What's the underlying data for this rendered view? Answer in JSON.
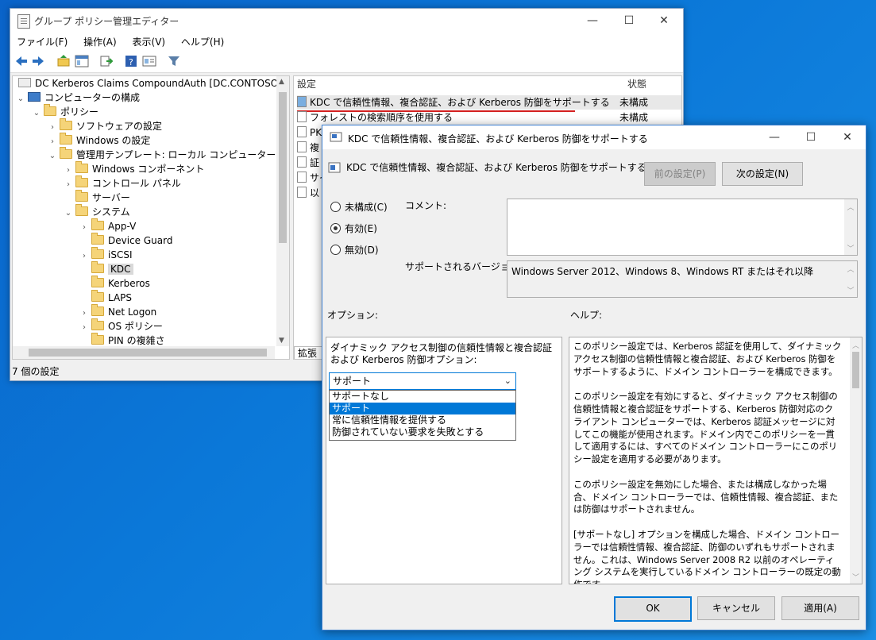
{
  "gpm": {
    "title": "グループ ポリシー管理エディター",
    "menu": [
      "ファイル(F)",
      "操作(A)",
      "表示(V)",
      "ヘルプ(H)"
    ],
    "tree": {
      "root": "DC Kerberos Claims CompoundAuth [DC.CONTOSO.COM]",
      "computer_config": "コンピューターの構成",
      "policies": "ポリシー",
      "software_settings": "ソフトウェアの設定",
      "windows_settings": "Windows の設定",
      "admin_templates": "管理用テンプレート: ローカル コンピューターから取得した",
      "windows_components": "Windows コンポーネント",
      "control_panel": "コントロール パネル",
      "server": "サーバー",
      "system": "システム",
      "system_children": [
        "App-V",
        "Device Guard",
        "iSCSI",
        "KDC",
        "Kerberos",
        "LAPS",
        "Net Logon",
        "OS ポリシー",
        "PIN の複雑さ"
      ]
    },
    "list": {
      "col_setting": "設定",
      "col_state": "状態",
      "rows": [
        {
          "name": "KDC で信頼性情報、複合認証、および Kerberos 防御をサポートする",
          "state": "未構成"
        },
        {
          "name": "フォレストの検索順序を使用する",
          "state": "未構成"
        },
        {
          "name": "PK",
          "state": ""
        },
        {
          "name": "複",
          "state": ""
        },
        {
          "name": "証",
          "state": ""
        },
        {
          "name": "サイ",
          "state": ""
        },
        {
          "name": "以",
          "state": ""
        }
      ],
      "tab_extended": "拡張"
    },
    "status": "7 個の設定"
  },
  "dialog": {
    "title": "KDC で信頼性情報、複合認証、および Kerberos 防御をサポートする",
    "header": "KDC で信頼性情報、複合認証、および Kerberos 防御をサポートする",
    "prev": "前の設定(P)",
    "next": "次の設定(N)",
    "radio_not_configured": "未構成(C)",
    "radio_enabled": "有効(E)",
    "radio_disabled": "無効(D)",
    "comment_label": "コメント:",
    "supported_label": "サポートされるバージョン:",
    "supported_value": "Windows Server 2012、Windows 8、Windows RT またはそれ以降",
    "options_label": "オプション:",
    "help_label": "ヘルプ:",
    "option_desc": "ダイナミック アクセス制御の信頼性情報と複合認証および Kerberos 防御オプション:",
    "combo_value": "サポート",
    "combo_items": [
      "サポートなし",
      "サポート",
      "常に信頼性情報を提供する",
      "防御されていない要求を失敗とする"
    ],
    "help_text": "このポリシー設定では、Kerberos 認証を使用して、ダイナミック アクセス制御の信頼性情報と複合認証、および Kerberos 防御をサポートするように、ドメイン コントローラーを構成できます。\n\nこのポリシー設定を有効にすると、ダイナミック アクセス制御の信頼性情報と複合認証をサポートする、Kerberos 防御対応のクライアント コンピューターでは、Kerberos 認証メッセージに対してこの機能が使用されます。ドメイン内でこのポリシーを一貫して適用するには、すべてのドメイン コントローラーにこのポリシー設定を適用する必要があります。\n\nこのポリシー設定を無効にした場合、または構成しなかった場合、ドメイン コントローラーでは、信頼性情報、複合認証、または防御はサポートされません。\n\n[サポートなし] オプションを構成した場合、ドメイン コントローラーでは信頼性情報、複合認証、防御のいずれもサポートされません。これは、Windows Server 2008 R2 以前のオペレーティング システムを実行しているドメイン コントローラーの既定の動作です。\n\n注: KDC ポリシーの以下のオプションを有効にするには、サポートされるシステムで Kerberos グループ ポリシーの [Kerberos クライアントで信頼",
    "ok": "OK",
    "cancel": "キャンセル",
    "apply": "適用(A)"
  },
  "colors": {
    "accent": "#0078d7",
    "underline": "#d42020"
  }
}
